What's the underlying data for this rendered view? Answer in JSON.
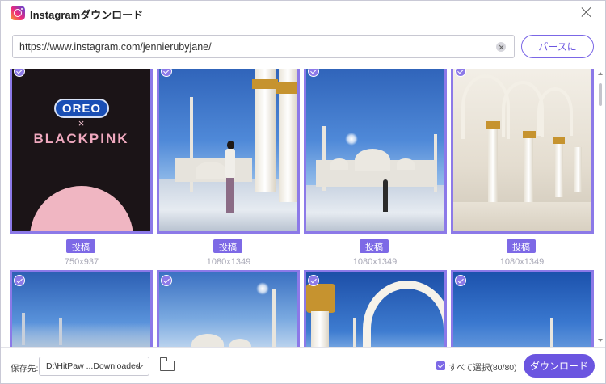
{
  "window": {
    "title": "Instagramダウンロード"
  },
  "url_bar": {
    "value": "https://www.instagram.com/jennierubyjane/",
    "paste_label": "パースに"
  },
  "tiles": [
    {
      "tag": "投稿",
      "size": "750x937",
      "promo_line1": "OREO",
      "promo_x": "×",
      "promo_line2": "BLACKPINK"
    },
    {
      "tag": "投稿",
      "size": "1080x1349"
    },
    {
      "tag": "投稿",
      "size": "1080x1349"
    },
    {
      "tag": "投稿",
      "size": "1080x1349"
    }
  ],
  "footer": {
    "save_label": "保存先:",
    "path": "D:\\HitPaw ...Downloaded",
    "select_all_label": "すべて選択(80/80)",
    "download_label": "ダウンロード"
  },
  "colors": {
    "accent": "#6b55e0",
    "tile_border": "#8c79e8"
  }
}
